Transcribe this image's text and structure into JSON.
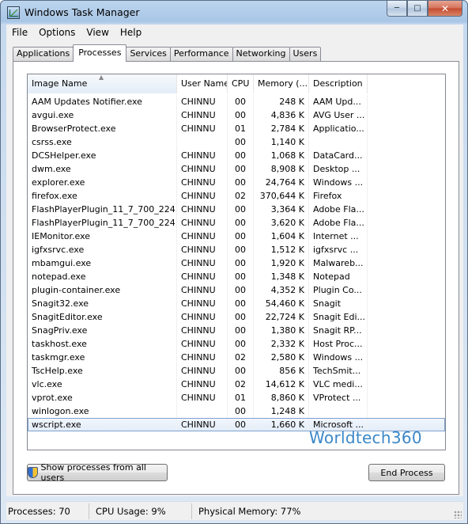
{
  "window": {
    "title": "Windows Task Manager",
    "minimize_glyph": "─",
    "maximize_glyph": "□",
    "close_glyph": "✕"
  },
  "menu": [
    "File",
    "Options",
    "View",
    "Help"
  ],
  "tabs": [
    "Applications",
    "Processes",
    "Services",
    "Performance",
    "Networking",
    "Users"
  ],
  "active_tab": "Processes",
  "columns": [
    "Image Name",
    "User Name",
    "CPU",
    "Memory (...",
    "Description"
  ],
  "processes": [
    {
      "name": "AAM Updates Notifier.exe",
      "user": "CHINNU",
      "cpu": "00",
      "memory": "248 K",
      "description": "AAM Upd..."
    },
    {
      "name": "avgui.exe",
      "user": "CHINNU",
      "cpu": "00",
      "memory": "4,836 K",
      "description": "AVG User ..."
    },
    {
      "name": "BrowserProtect.exe",
      "user": "CHINNU",
      "cpu": "01",
      "memory": "2,784 K",
      "description": "Applicatio..."
    },
    {
      "name": "csrss.exe",
      "user": "",
      "cpu": "00",
      "memory": "1,140 K",
      "description": ""
    },
    {
      "name": "DCSHelper.exe",
      "user": "CHINNU",
      "cpu": "00",
      "memory": "1,068 K",
      "description": "DataCard..."
    },
    {
      "name": "dwm.exe",
      "user": "CHINNU",
      "cpu": "00",
      "memory": "8,908 K",
      "description": "Desktop ..."
    },
    {
      "name": "explorer.exe",
      "user": "CHINNU",
      "cpu": "00",
      "memory": "24,764 K",
      "description": "Windows ..."
    },
    {
      "name": "firefox.exe",
      "user": "CHINNU",
      "cpu": "02",
      "memory": "370,644 K",
      "description": "Firefox"
    },
    {
      "name": "FlashPlayerPlugin_11_7_700_224....",
      "user": "CHINNU",
      "cpu": "00",
      "memory": "3,364 K",
      "description": "Adobe Fla..."
    },
    {
      "name": "FlashPlayerPlugin_11_7_700_224....",
      "user": "CHINNU",
      "cpu": "00",
      "memory": "3,620 K",
      "description": "Adobe Fla..."
    },
    {
      "name": "IEMonitor.exe",
      "user": "CHINNU",
      "cpu": "00",
      "memory": "1,604 K",
      "description": "Internet ..."
    },
    {
      "name": "igfxsrvc.exe",
      "user": "CHINNU",
      "cpu": "00",
      "memory": "1,512 K",
      "description": "igfxsrvc ..."
    },
    {
      "name": "mbamgui.exe",
      "user": "CHINNU",
      "cpu": "00",
      "memory": "1,920 K",
      "description": "Malwareb..."
    },
    {
      "name": "notepad.exe",
      "user": "CHINNU",
      "cpu": "00",
      "memory": "1,348 K",
      "description": "Notepad"
    },
    {
      "name": "plugin-container.exe",
      "user": "CHINNU",
      "cpu": "00",
      "memory": "4,352 K",
      "description": "Plugin Co..."
    },
    {
      "name": "Snagit32.exe",
      "user": "CHINNU",
      "cpu": "00",
      "memory": "54,460 K",
      "description": "Snagit"
    },
    {
      "name": "SnagitEditor.exe",
      "user": "CHINNU",
      "cpu": "00",
      "memory": "22,724 K",
      "description": "Snagit Edi..."
    },
    {
      "name": "SnagPriv.exe",
      "user": "CHINNU",
      "cpu": "00",
      "memory": "1,380 K",
      "description": "Snagit RP..."
    },
    {
      "name": "taskhost.exe",
      "user": "CHINNU",
      "cpu": "00",
      "memory": "2,332 K",
      "description": "Host Proc..."
    },
    {
      "name": "taskmgr.exe",
      "user": "CHINNU",
      "cpu": "02",
      "memory": "2,580 K",
      "description": "Windows ..."
    },
    {
      "name": "TscHelp.exe",
      "user": "CHINNU",
      "cpu": "00",
      "memory": "856 K",
      "description": "TechSmit..."
    },
    {
      "name": "vlc.exe",
      "user": "CHINNU",
      "cpu": "02",
      "memory": "14,612 K",
      "description": "VLC medi..."
    },
    {
      "name": "vprot.exe",
      "user": "CHINNU",
      "cpu": "01",
      "memory": "8,860 K",
      "description": "VProtect ..."
    },
    {
      "name": "winlogon.exe",
      "user": "",
      "cpu": "00",
      "memory": "1,248 K",
      "description": ""
    },
    {
      "name": "wscript.exe",
      "user": "CHINNU",
      "cpu": "00",
      "memory": "1,660 K",
      "description": "Microsoft ...",
      "selected": true
    }
  ],
  "watermark": "Worldtech360",
  "buttons": {
    "show_all": "Show processes from all users",
    "end_process": "End Process"
  },
  "status": {
    "processes": "Processes: 70",
    "cpu": "CPU Usage: 9%",
    "memory": "Physical Memory: 77%"
  },
  "colors": {
    "selection_border": "#7da2ce",
    "watermark": "#3b87c8",
    "close_button": "#c34a2e"
  }
}
